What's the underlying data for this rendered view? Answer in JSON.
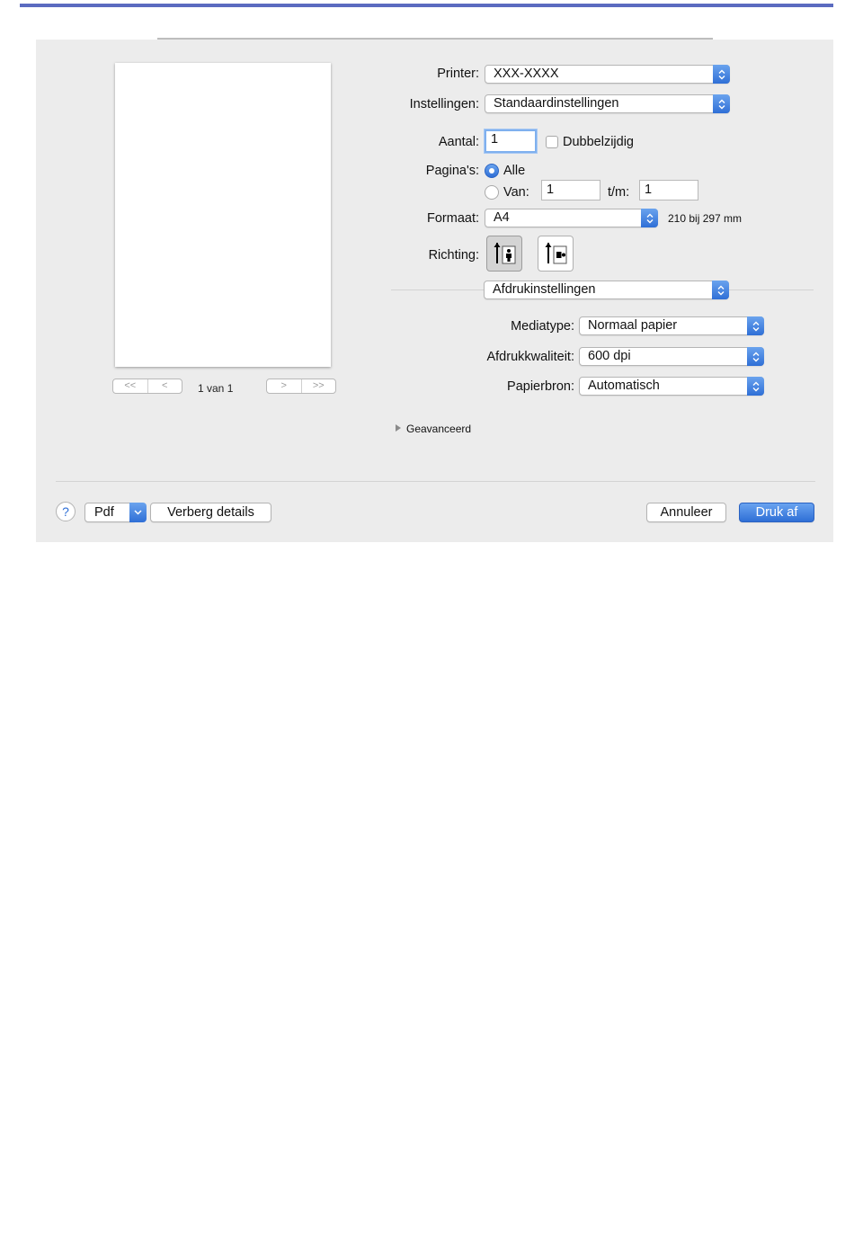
{
  "preview": {
    "nav_first": "<<",
    "nav_prev": "<",
    "nav_next": ">",
    "nav_last": ">>",
    "page_counter": "1 van 1"
  },
  "printer": {
    "label": "Printer:",
    "value": "XXX-XXXX"
  },
  "presets": {
    "label": "Instellingen:",
    "value": "Standaardinstellingen"
  },
  "copies": {
    "label": "Aantal:",
    "value": "1",
    "duplex_label": "Dubbelzijdig",
    "duplex_checked": false
  },
  "pages": {
    "label": "Pagina's:",
    "all_label": "Alle",
    "range_label": "Van:",
    "from_value": "1",
    "to_label": "t/m:",
    "to_value": "1",
    "selected": "all"
  },
  "paper_size": {
    "label": "Formaat:",
    "value": "A4",
    "dimensions": "210 bij 297 mm"
  },
  "orientation": {
    "label": "Richting:",
    "selected": "portrait"
  },
  "section": {
    "value": "Afdrukinstellingen"
  },
  "media_type": {
    "label": "Mediatype:",
    "value": "Normaal papier"
  },
  "print_quality": {
    "label": "Afdrukkwaliteit:",
    "value": "600 dpi"
  },
  "paper_source": {
    "label": "Papierbron:",
    "value": "Automatisch"
  },
  "advanced": {
    "label": "Geavanceerd"
  },
  "footer": {
    "help": "?",
    "pdf": "Pdf",
    "hide_details": "Verberg details",
    "cancel": "Annuleer",
    "print": "Druk af"
  },
  "colors": {
    "accent": "#2f6fd6",
    "topline": "#5b6bc0"
  }
}
